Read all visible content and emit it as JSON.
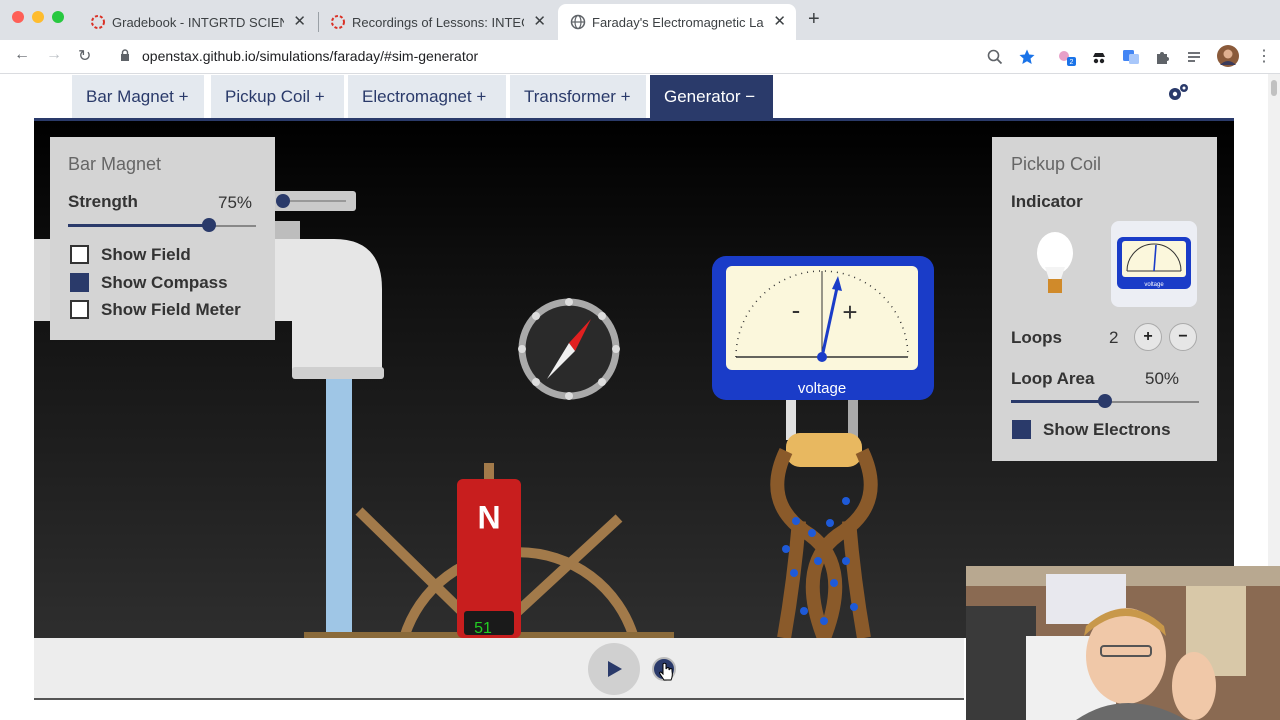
{
  "browser": {
    "tabs": [
      {
        "title": "Gradebook - INTGRTD SCIENCE",
        "icon": "spinner-icon"
      },
      {
        "title": "Recordings of Lessons: INTEGRATED",
        "icon": "spinner-icon"
      },
      {
        "title": "Faraday's Electromagnetic Lab",
        "icon": "globe-icon"
      }
    ],
    "new_tab_label": "+",
    "close_glyph": "✕",
    "url": "openstax.github.io/simulations/faraday/#sim-generator",
    "extension_badge": "2"
  },
  "sim_tabs": [
    {
      "label": "Bar Magnet +"
    },
    {
      "label": "Pickup Coil +"
    },
    {
      "label": "Electromagnet +"
    },
    {
      "label": "Transformer +"
    },
    {
      "label": "Generator −"
    }
  ],
  "bar_magnet_panel": {
    "title": "Bar Magnet",
    "strength_label": "Strength",
    "strength_value": "75%",
    "strength_fraction": 0.75,
    "checkboxes": [
      {
        "label": "Show Field",
        "checked": false
      },
      {
        "label": "Show Compass",
        "checked": true
      },
      {
        "label": "Show Field Meter",
        "checked": false
      }
    ]
  },
  "pickup_coil_panel": {
    "title": "Pickup Coil",
    "indicator_label": "Indicator",
    "loops_label": "Loops",
    "loops_value": "2",
    "loop_area_label": "Loop Area",
    "loop_area_value": "50%",
    "loop_area_fraction": 0.5,
    "show_electrons_label": "Show Electrons",
    "show_electrons_checked": true
  },
  "meter": {
    "minus": "-",
    "plus": "+",
    "caption": "voltage",
    "thumb_caption": "voltage"
  },
  "magnet": {
    "pole_label": "N",
    "rpm_readout": "51"
  },
  "colors": {
    "accent": "#2a3a6a",
    "tab_bg": "#e4e9ef",
    "panel_bg": "#d4d4d4",
    "meter_blue": "#1a3cc8",
    "magnet_red": "#c81e1e"
  }
}
